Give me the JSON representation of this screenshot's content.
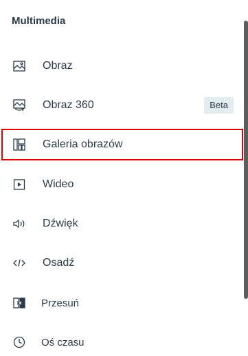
{
  "section": {
    "title": "Multimedia"
  },
  "items": [
    {
      "label": "Obraz",
      "icon": "image-icon"
    },
    {
      "label": "Obraz 360",
      "icon": "image-360-icon",
      "badge": "Beta"
    },
    {
      "label": "Galeria obrazów",
      "icon": "gallery-icon",
      "selected": true
    },
    {
      "label": "Wideo",
      "icon": "video-icon"
    },
    {
      "label": "Dźwięk",
      "icon": "audio-icon"
    },
    {
      "label": "Osadź",
      "icon": "embed-icon"
    },
    {
      "label": "Przesuń",
      "icon": "swipe-icon"
    },
    {
      "label": "Oś czasu",
      "icon": "timeline-icon"
    }
  ],
  "colors": {
    "text": "#2b3a4a",
    "badge_bg": "#e3ecef",
    "selected_outline": "#e00000",
    "scrollbar": "#5d5d5d"
  }
}
